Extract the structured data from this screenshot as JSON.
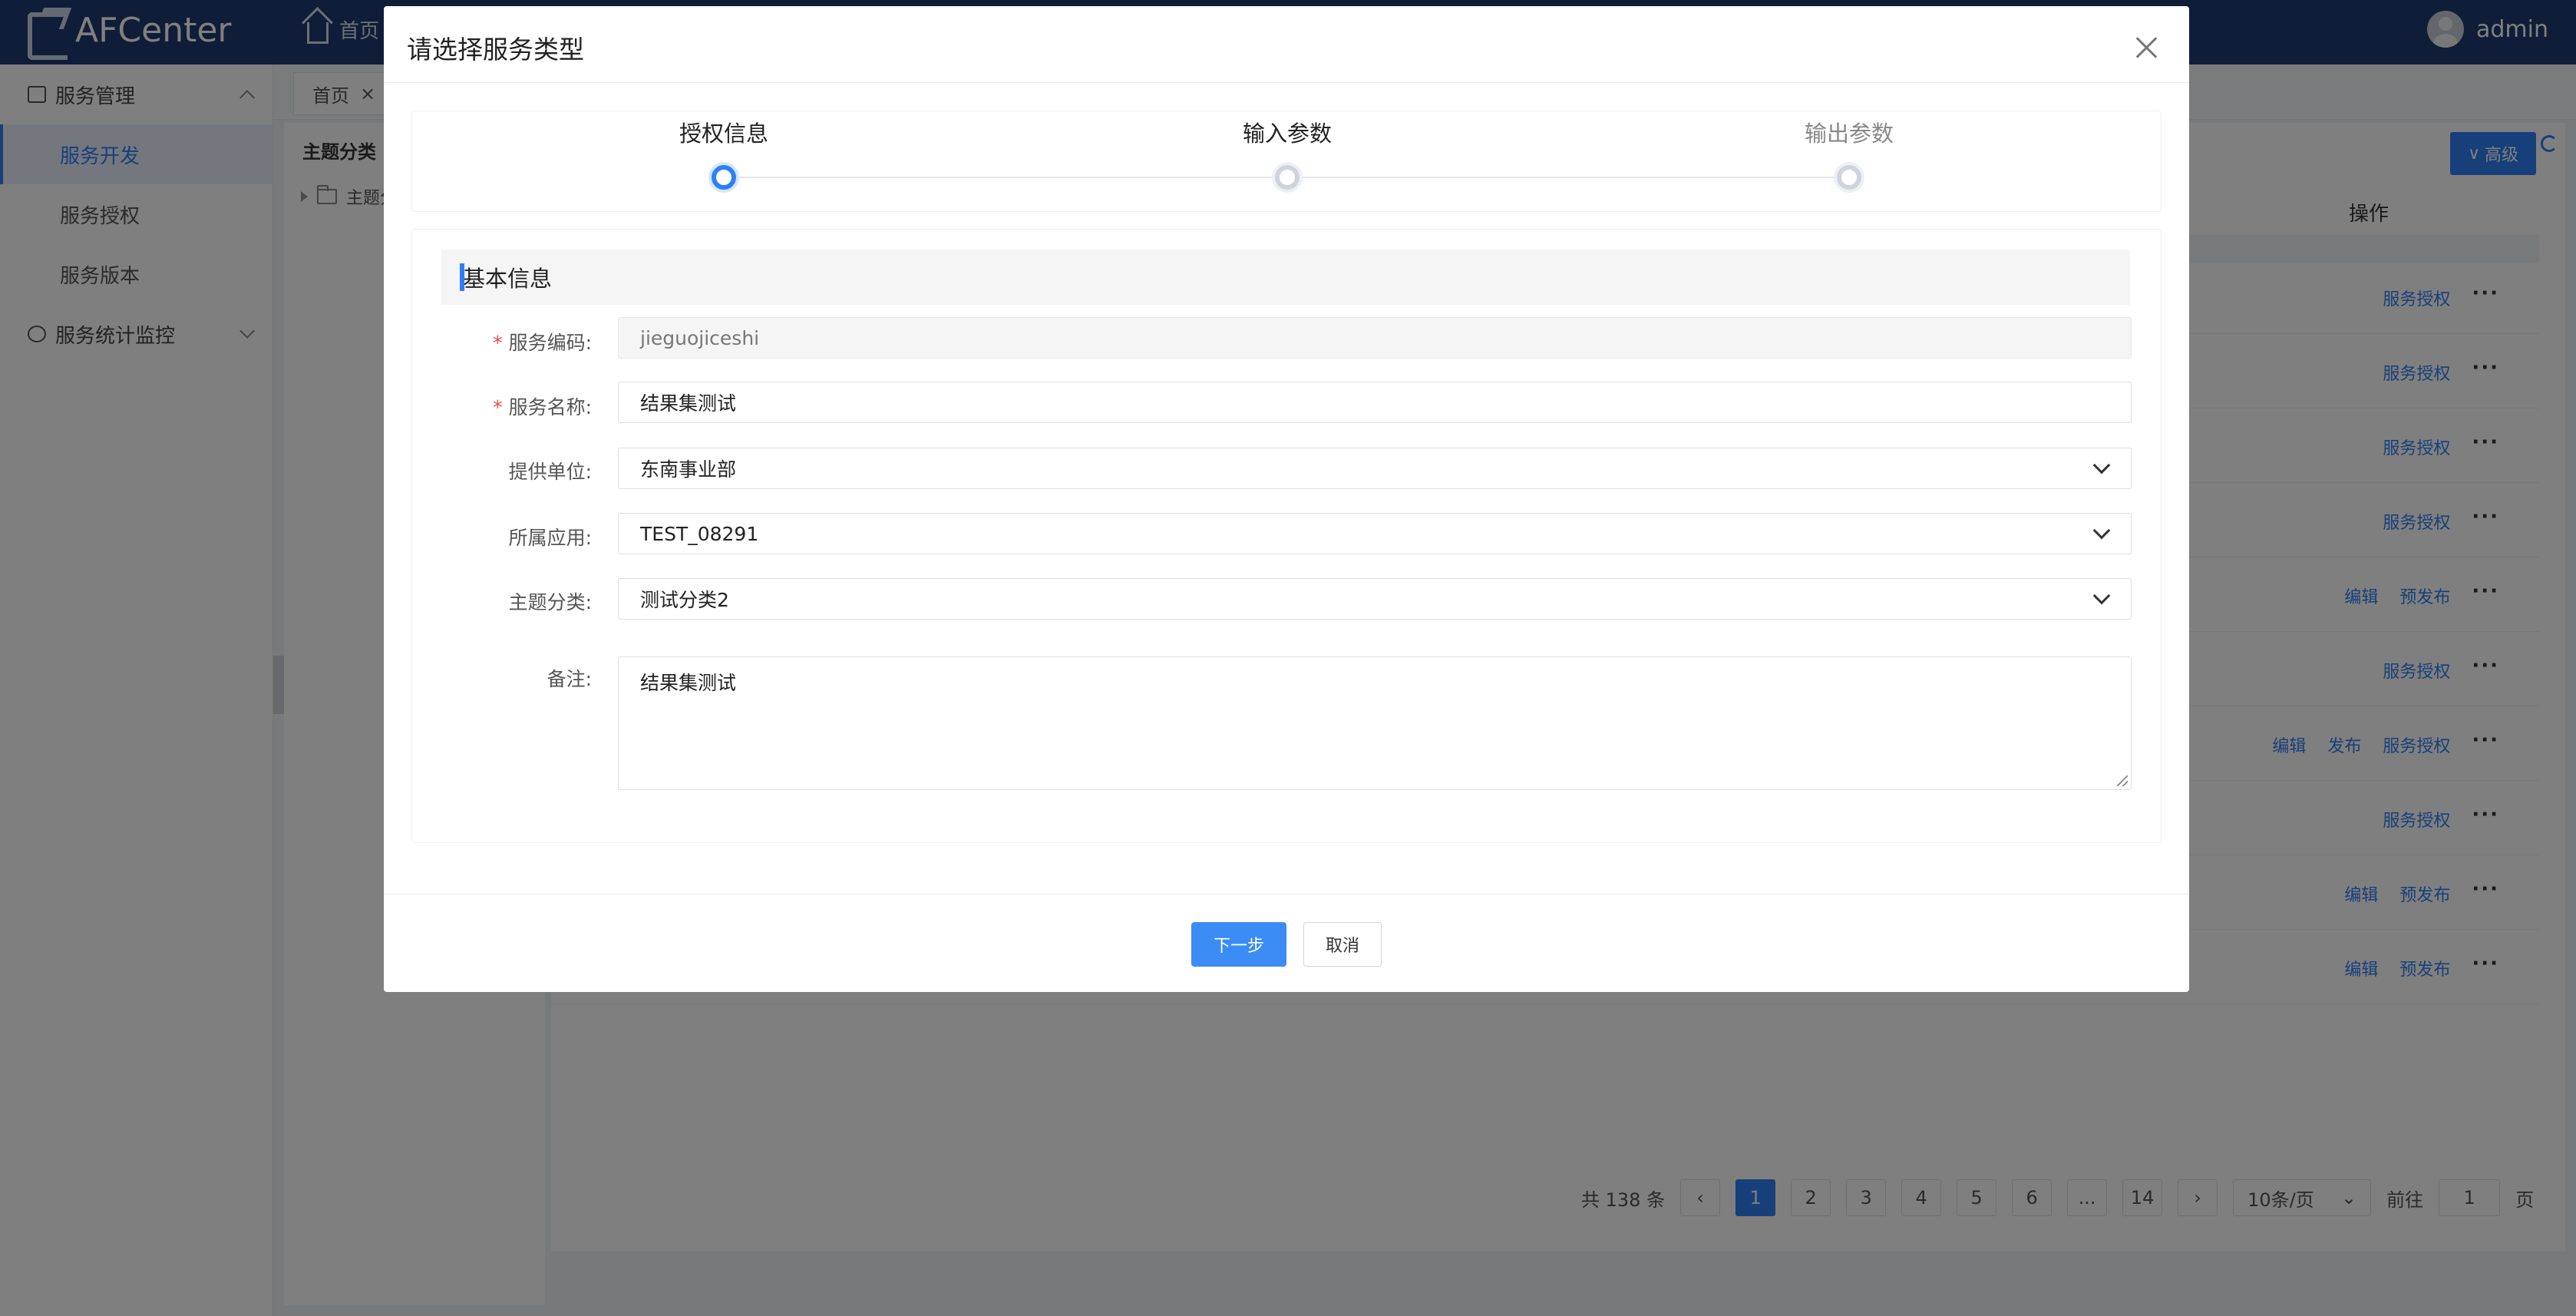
{
  "app": {
    "title": "AFCenter",
    "user": "admin"
  },
  "topnav": {
    "home": "首页"
  },
  "sidebar": {
    "groups": [
      {
        "label": "服务管理",
        "expanded": true,
        "items": [
          "服务开发",
          "服务授权",
          "服务版本"
        ],
        "active": "服务开发"
      },
      {
        "label": "服务统计监控",
        "expanded": false
      }
    ]
  },
  "tabs": [
    {
      "label": "首页",
      "close": "×"
    }
  ],
  "tree": {
    "title": "主题分类",
    "node": "主题分"
  },
  "toolbar": {
    "advanced": "高级"
  },
  "table": {
    "action_header": "操作",
    "rows": [
      [
        "服务授权"
      ],
      [
        "服务授权"
      ],
      [
        "服务授权"
      ],
      [
        "服务授权"
      ],
      [
        "编辑",
        "预发布"
      ],
      [
        "服务授权"
      ],
      [
        "编辑",
        "发布",
        "服务授权"
      ],
      [
        "服务授权"
      ],
      [
        "编辑",
        "预发布"
      ],
      [
        "编辑",
        "预发布"
      ]
    ],
    "more": "···"
  },
  "pagination": {
    "total": "共 138 条",
    "pages": [
      "1",
      "2",
      "3",
      "4",
      "5",
      "6",
      "...",
      "14"
    ],
    "current": "1",
    "page_size": "10条/页",
    "goto_label": "前往",
    "goto_value": "1",
    "goto_suffix": "页"
  },
  "modal": {
    "title": "请选择服务类型",
    "steps": [
      {
        "label": "授权信息",
        "state": "active"
      },
      {
        "label": "输入参数",
        "state": "done"
      },
      {
        "label": "输出参数",
        "state": "pending"
      }
    ],
    "section": "基本信息",
    "fields": {
      "service_code": {
        "label": "服务编码:",
        "value": "jieguojiceshi",
        "required": true
      },
      "service_name": {
        "label": "服务名称:",
        "value": "结果集测试",
        "required": true
      },
      "provider": {
        "label": "提供单位:",
        "value": "东南事业部"
      },
      "application": {
        "label": "所属应用:",
        "value": "TEST_08291"
      },
      "category": {
        "label": "主题分类:",
        "value": "测试分类2"
      },
      "remark": {
        "label": "备注:",
        "value": "结果集测试"
      }
    },
    "required_mark": "*",
    "buttons": {
      "next": "下一步",
      "cancel": "取消"
    }
  },
  "colors": {
    "primary": "#2f7ef5",
    "topbar": "#1f3a70",
    "required": "#e74c3c"
  }
}
